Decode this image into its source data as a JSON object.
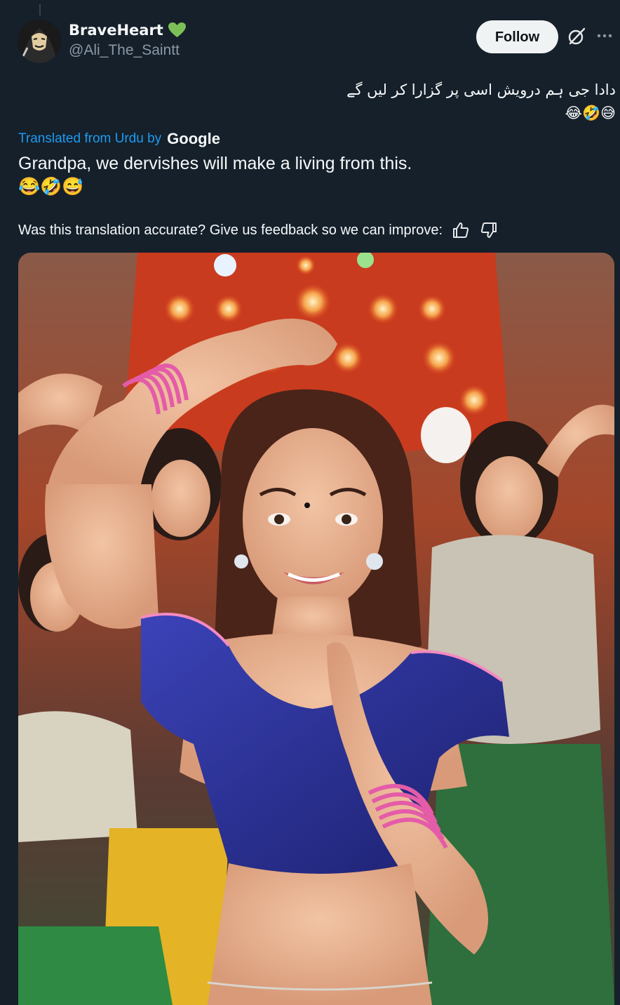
{
  "post": {
    "author": {
      "display_name": "BraveHeart",
      "handle": "@Ali_The_Saintt",
      "badge_icon": "green-heart-icon",
      "badge_color": "#7dbf57"
    },
    "follow_label": "Follow",
    "original_text": "دادا جی ہم درویش اسی پر گزارا کر لیں گے\n😅🤣😂",
    "translation": {
      "source_label": "Translated from Urdu by",
      "provider": "Google",
      "text": "Grandpa, we dervishes will make a living from this.\n😂🤣😅"
    },
    "feedback": {
      "prompt": "Was this translation accurate? Give us feedback so we can improve:"
    },
    "media": {
      "kind": "photo"
    }
  },
  "colors": {
    "background": "#15202b",
    "text_primary": "#f7f9f9",
    "text_secondary": "#8b98a5",
    "link_blue": "#1d9bf0",
    "follow_bg": "#eff3f4"
  }
}
